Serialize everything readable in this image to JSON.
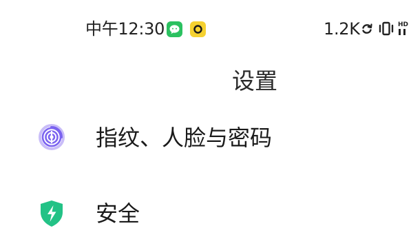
{
  "status_bar": {
    "time": "中午12:30",
    "network_speed": "1.2K",
    "icons": [
      "wechat-icon",
      "yellow-app-icon",
      "sync-icon",
      "vibrate-icon",
      "hd-icon"
    ],
    "hd_label": "HD"
  },
  "page": {
    "title": "设置"
  },
  "settings": {
    "items": [
      {
        "label": "指纹、人脸与密码",
        "icon": "fingerprint-icon",
        "icon_color": "#7b63f0"
      },
      {
        "label": "安全",
        "icon": "security-shield-icon",
        "icon_color": "#23c286"
      }
    ]
  },
  "colors": {
    "background": "#ffffff",
    "text": "#1a1a1a",
    "wechat_green": "#2bc160",
    "notification_yellow": "#f5d130"
  }
}
